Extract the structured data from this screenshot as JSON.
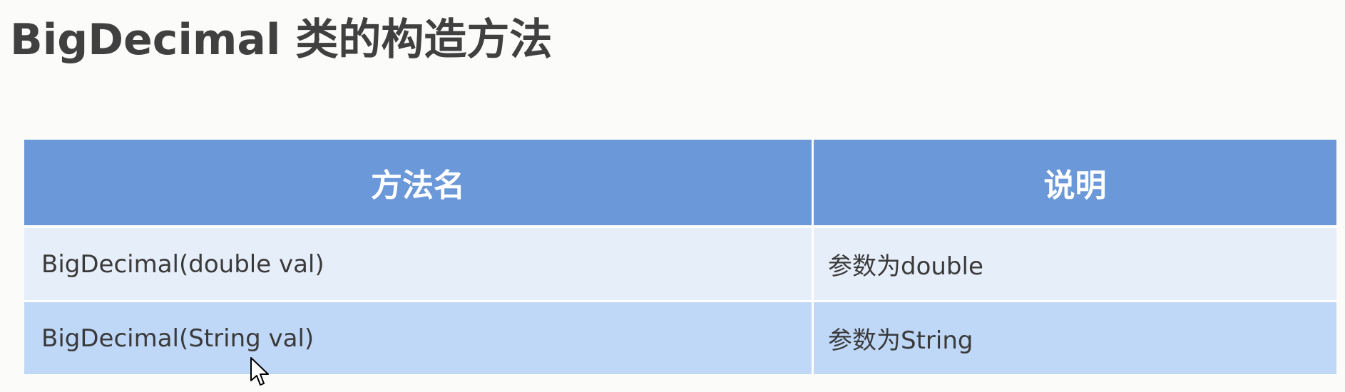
{
  "slide": {
    "title": "BigDecimal 类的构造方法"
  },
  "table": {
    "headers": [
      "方法名",
      "说明"
    ],
    "rows": [
      {
        "method": "BigDecimal(double val)",
        "description": "参数为double"
      },
      {
        "method": "BigDecimal(String val)",
        "description": "参数为String"
      }
    ]
  },
  "colors": {
    "header_bg": "#6b98d8",
    "row_light": "#e6eefa",
    "row_dark": "#c0d8f8",
    "title_text": "#404040"
  },
  "icons": {
    "cursor": "mouse-pointer-icon"
  }
}
